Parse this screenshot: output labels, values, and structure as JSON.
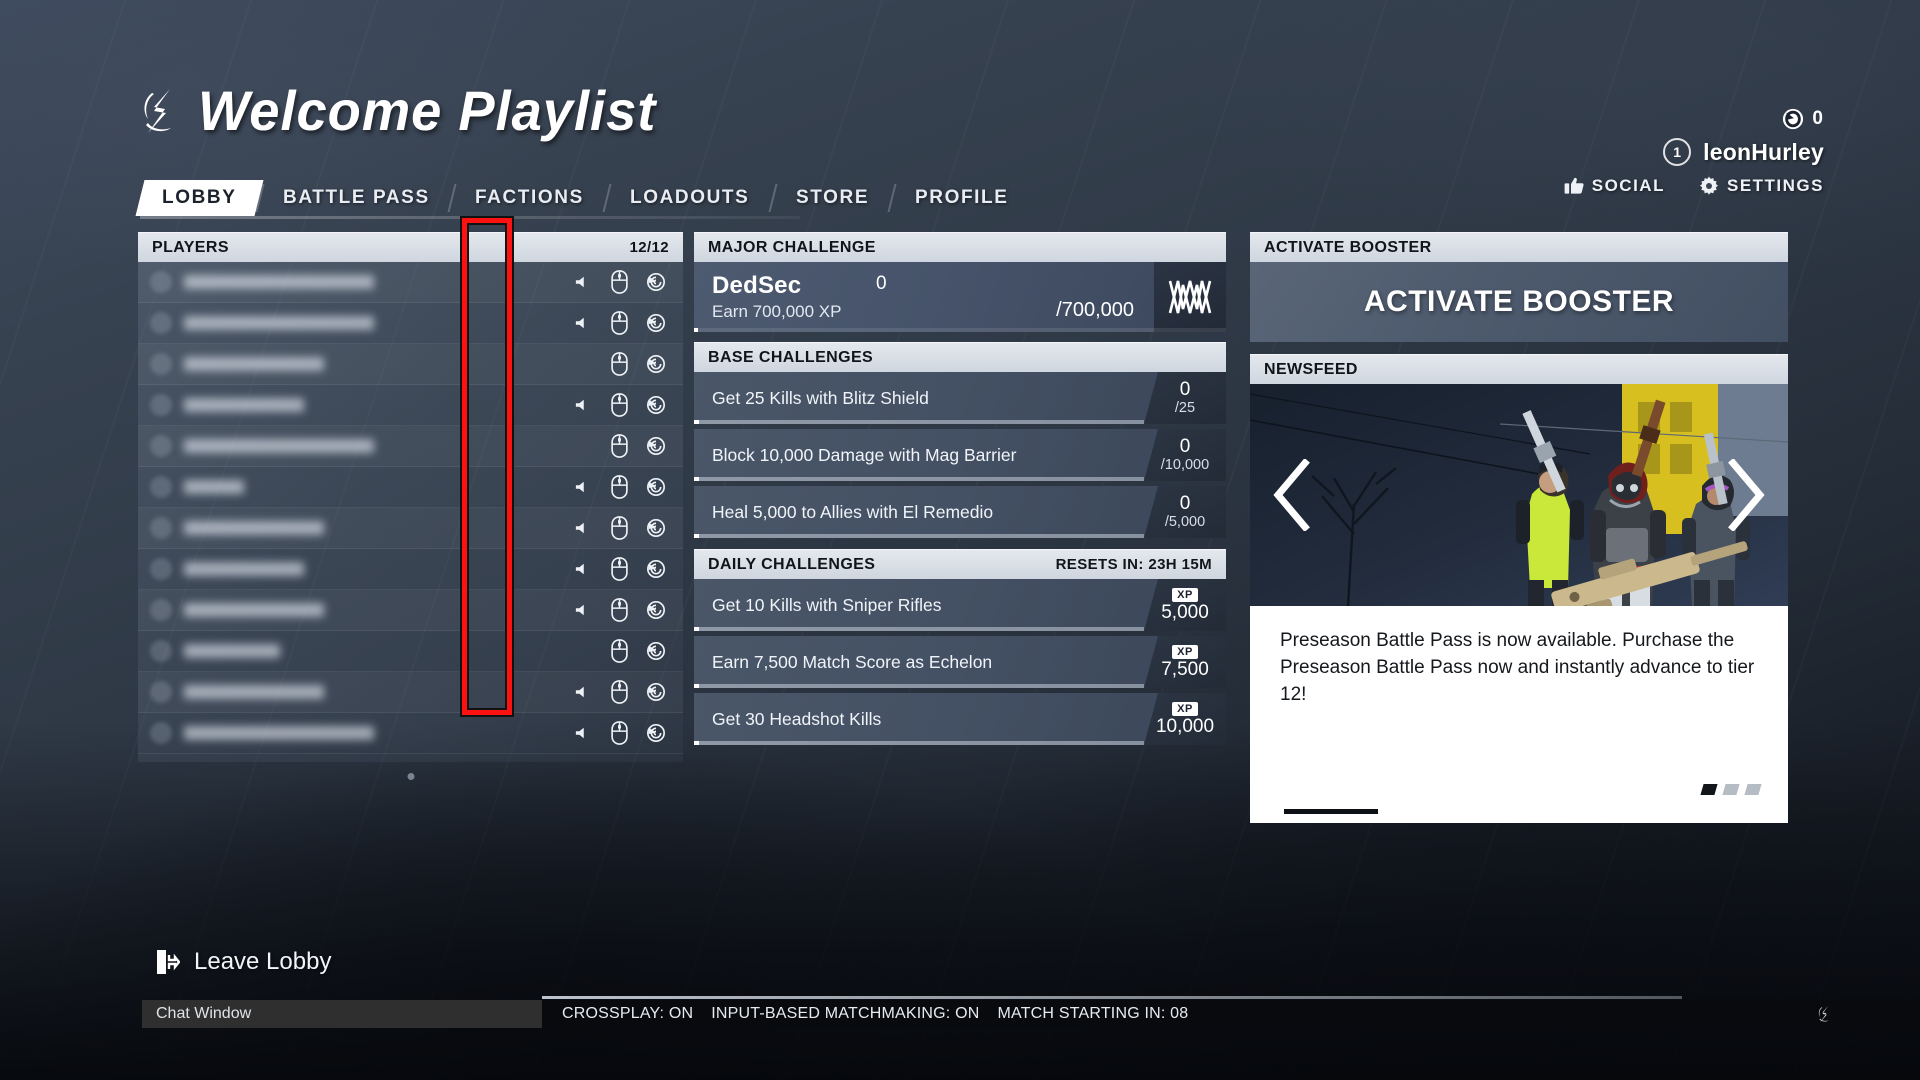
{
  "header": {
    "title": "Welcome Playlist",
    "logo_icon": "xdefiant-logo-icon"
  },
  "nav": {
    "tabs": [
      {
        "label": "LOBBY",
        "active": true
      },
      {
        "label": "BATTLE PASS",
        "active": false
      },
      {
        "label": "FACTIONS",
        "active": false
      },
      {
        "label": "LOADOUTS",
        "active": false
      },
      {
        "label": "STORE",
        "active": false
      },
      {
        "label": "PROFILE",
        "active": false
      }
    ]
  },
  "userbar": {
    "currency_icon": "ubisoft-credits-icon",
    "currency_amount": "0",
    "level": "1",
    "username": "leonHurley",
    "social_label": "SOCIAL",
    "social_icon": "thumbs-up-icon",
    "settings_label": "SETTINGS",
    "settings_icon": "gear-icon"
  },
  "players": {
    "header": "PLAYERS",
    "count": "12/12",
    "rows": [
      {
        "name_width": "w2",
        "has_voice": true,
        "input_icon": "mouse-icon",
        "platform_icon": "ubisoft-icon"
      },
      {
        "name_width": "w2",
        "has_voice": true,
        "input_icon": "mouse-icon",
        "platform_icon": "ubisoft-icon"
      },
      {
        "name_width": "w3",
        "has_voice": false,
        "input_icon": "mouse-icon",
        "platform_icon": "ubisoft-icon"
      },
      {
        "name_width": "w1",
        "has_voice": true,
        "input_icon": "mouse-icon",
        "platform_icon": "ubisoft-icon"
      },
      {
        "name_width": "w2",
        "has_voice": false,
        "input_icon": "mouse-icon",
        "platform_icon": "ubisoft-icon"
      },
      {
        "name_width": "w5",
        "has_voice": true,
        "input_icon": "mouse-icon",
        "platform_icon": "ubisoft-icon"
      },
      {
        "name_width": "w3",
        "has_voice": true,
        "input_icon": "mouse-icon",
        "platform_icon": "ubisoft-icon"
      },
      {
        "name_width": "w1",
        "has_voice": true,
        "input_icon": "mouse-icon",
        "platform_icon": "ubisoft-icon"
      },
      {
        "name_width": "w3",
        "has_voice": true,
        "input_icon": "mouse-icon",
        "platform_icon": "ubisoft-icon"
      },
      {
        "name_width": "w4",
        "has_voice": false,
        "input_icon": "mouse-icon",
        "platform_icon": "ubisoft-icon"
      },
      {
        "name_width": "w3",
        "has_voice": true,
        "input_icon": "mouse-icon",
        "platform_icon": "ubisoft-icon"
      },
      {
        "name_width": "w2",
        "has_voice": true,
        "input_icon": "mouse-icon",
        "platform_icon": "ubisoft-icon"
      }
    ],
    "annotation_color": "#fd1212"
  },
  "major_challenge": {
    "header": "MAJOR CHALLENGE",
    "faction": "DedSec",
    "description": "Earn 700,000 XP",
    "current": "0",
    "goal": "/700,000",
    "badge_icon": "dedsec-icon"
  },
  "base_challenges": {
    "header": "BASE CHALLENGES",
    "items": [
      {
        "text": "Get 25 Kills with Blitz Shield",
        "current": "0",
        "goal": "/25"
      },
      {
        "text": "Block 10,000 Damage with Mag Barrier",
        "current": "0",
        "goal": "/10,000"
      },
      {
        "text": "Heal 5,000 to Allies with El Remedio",
        "current": "0",
        "goal": "/5,000"
      }
    ]
  },
  "daily_challenges": {
    "header": "DAILY CHALLENGES",
    "reset": "RESETS IN: 23H 15M",
    "items": [
      {
        "text": "Get 10 Kills with Sniper Rifles",
        "chip": "XP",
        "reward": "5,000"
      },
      {
        "text": "Earn 7,500 Match Score as Echelon",
        "chip": "XP",
        "reward": "7,500"
      },
      {
        "text": "Get 30 Headshot Kills",
        "chip": "XP",
        "reward": "10,000"
      }
    ]
  },
  "booster": {
    "header": "ACTIVATE BOOSTER",
    "button_label": "ACTIVATE BOOSTER"
  },
  "newsfeed": {
    "header": "NEWSFEED",
    "prev_icon": "chevron-left-icon",
    "next_icon": "chevron-right-icon",
    "body": "Preseason Battle Pass is now available. Purchase the Preseason Battle Pass now and instantly advance to tier 12!",
    "dots": [
      {
        "active": true
      },
      {
        "active": false
      },
      {
        "active": false
      }
    ]
  },
  "footer": {
    "leave_lobby_label": "Leave Lobby",
    "leave_lobby_icon": "exit-door-icon",
    "chat_window_label": "Chat Window",
    "status": {
      "crossplay": "CROSSPLAY: ON",
      "matchmaking": "INPUT-BASED MATCHMAKING: ON",
      "match_timer": "MATCH STARTING IN: 08"
    },
    "status_logo_icon": "xdefiant-logo-icon"
  }
}
